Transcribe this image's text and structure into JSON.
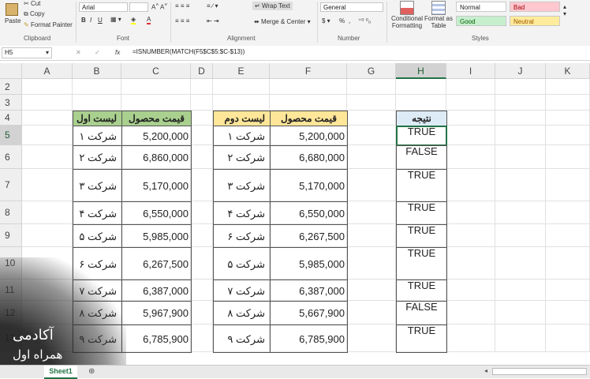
{
  "ribbon": {
    "clipboard": {
      "paste": "Paste",
      "cut": "Cut",
      "copy": "Copy",
      "format_painter": "Format Painter",
      "group": "Clipboard"
    },
    "font": {
      "name": "Arial",
      "group": "Font",
      "bold": "B",
      "italic": "I",
      "underline": "U"
    },
    "alignment": {
      "wrap_text": "Wrap Text",
      "merge": "Merge & Center",
      "group": "Alignment"
    },
    "number": {
      "format": "General",
      "percent": "%",
      "comma": ",",
      "group": "Number"
    },
    "styles": {
      "conditional": "Conditional",
      "formatting": "Formatting",
      "format_as": "Format as",
      "table": "Table",
      "normal": "Normal",
      "bad": "Bad",
      "good": "Good",
      "neutral": "Neutral",
      "group": "Styles"
    }
  },
  "formula_bar": {
    "cell_ref": "H5",
    "fx": "fx",
    "formula": "=ISNUMBER(MATCH(F5$C$5:$C-$13))"
  },
  "columns": [
    "A",
    "B",
    "C",
    "D",
    "E",
    "F",
    "G",
    "H",
    "I",
    "J",
    "K"
  ],
  "rows": [
    "2",
    "3",
    "4",
    "5",
    "6",
    "7",
    "8",
    "9",
    "10",
    "11",
    "12",
    "13"
  ],
  "table1": {
    "header_name": "لیست اول",
    "header_price": "قیمت محصول",
    "names": [
      "شرکت ۱",
      "شرکت ۲",
      "شرکت ۳",
      "شرکت ۴",
      "شرکت ۵",
      "شرکت ۶",
      "شرکت ۷",
      "شرکت ۸",
      "شرکت ۹"
    ],
    "prices": [
      "5,200,000",
      "6,860,000",
      "5,170,000",
      "6,550,000",
      "5,985,000",
      "6,267,500",
      "6,387,000",
      "5,967,900",
      "6,785,900"
    ]
  },
  "table2": {
    "header_name": "لیست دوم",
    "header_price": "قیمت محصول",
    "names": [
      "شرکت ۱",
      "شرکت ۲",
      "شرکت ۳",
      "شرکت ۴",
      "شرکت ۶",
      "شرکت ۵",
      "شرکت ۷",
      "شرکت ۸",
      "شرکت ۹"
    ],
    "prices": [
      "5,200,000",
      "6,680,000",
      "5,170,000",
      "6,550,000",
      "6,267,500",
      "5,985,000",
      "6,387,000",
      "5,667,900",
      "6,785,900"
    ]
  },
  "result": {
    "header": "نتیجه",
    "values": [
      "TRUE",
      "FALSE",
      "TRUE",
      "TRUE",
      "TRUE",
      "TRUE",
      "TRUE",
      "FALSE",
      "TRUE"
    ]
  },
  "sheet_tab": "Sheet1",
  "watermark": {
    "line1": "آکادمی",
    "line2": "همراه اول"
  },
  "colors": {
    "green_header": "#a9d08e",
    "yellow_header": "#ffe699",
    "blue_header": "#ddebf7",
    "bad": "#ffc7ce",
    "good": "#c6efce",
    "neutral": "#ffeb9c",
    "accent": "#217346"
  }
}
